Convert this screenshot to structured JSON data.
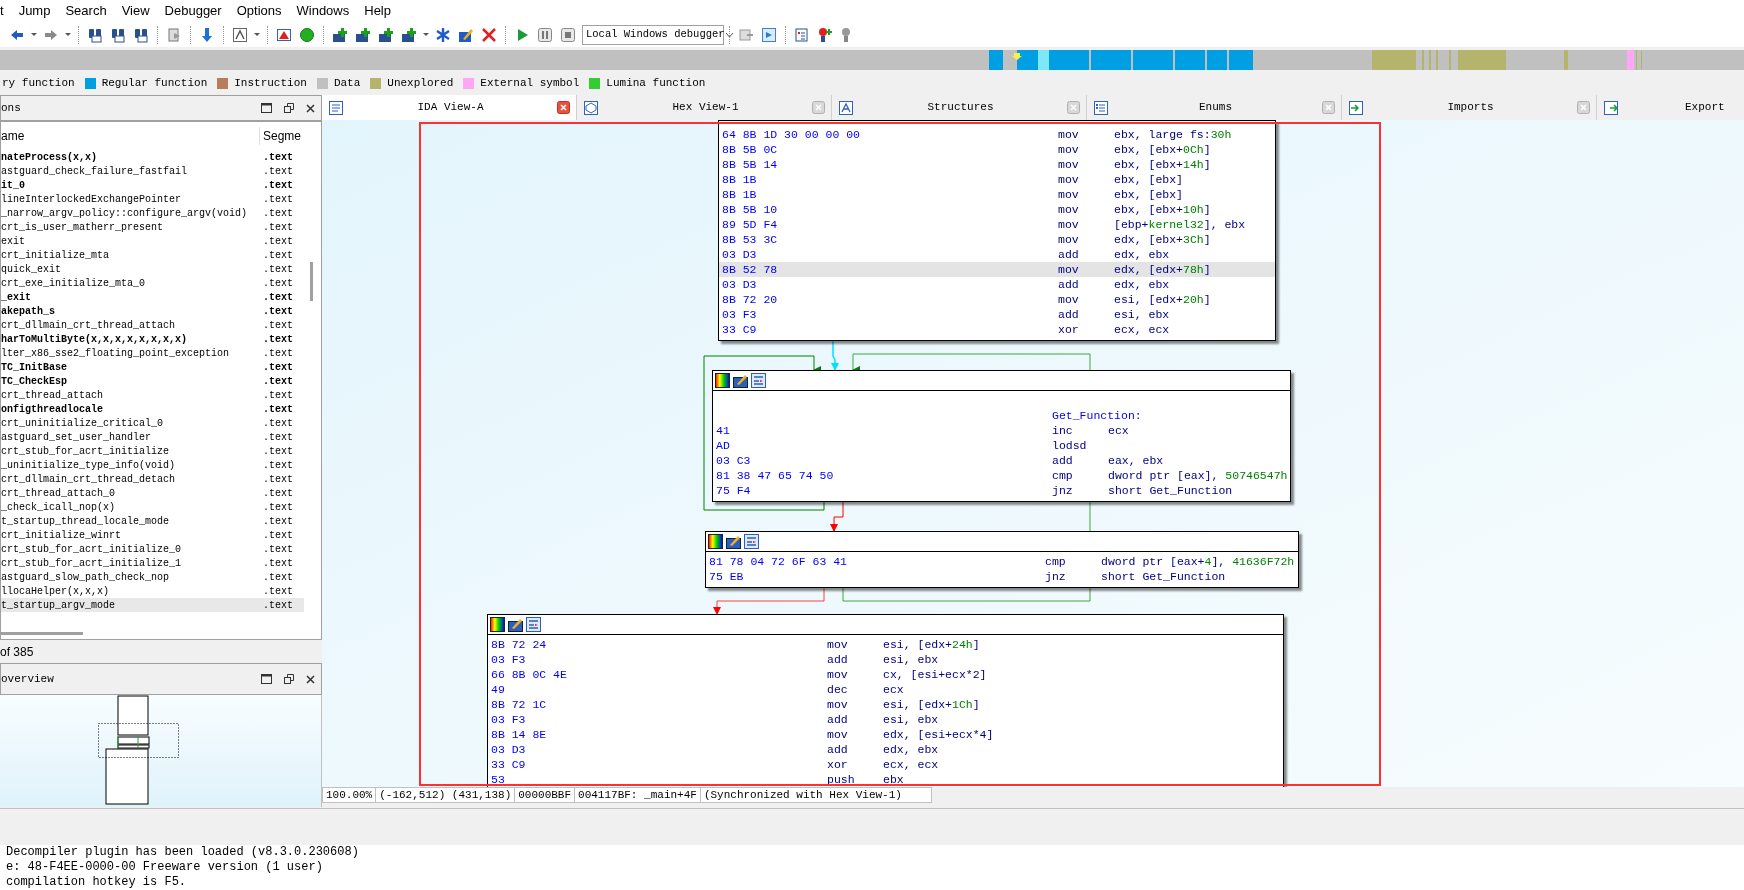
{
  "menu": [
    "t",
    "Jump",
    "Search",
    "View",
    "Debugger",
    "Options",
    "Windows",
    "Help"
  ],
  "toolbar": {
    "debugger_dropdown": "Local Windows debugger"
  },
  "legend": [
    {
      "label": "ry function"
    },
    {
      "label": "Regular function",
      "color": "#009fe3"
    },
    {
      "label": "Instruction",
      "color": "#b87c5c"
    },
    {
      "label": "Data",
      "color": "#c0c0c0"
    },
    {
      "label": "Unexplored",
      "color": "#b4b46c"
    },
    {
      "label": "External symbol",
      "color": "#ffa6f5"
    },
    {
      "label": "Lumina function",
      "color": "#33cc33"
    }
  ],
  "functions_panel": {
    "title": "ons",
    "columns": [
      "ame",
      "Segme"
    ],
    "rows": [
      {
        "name": "nateProcess(x,x)",
        "segment": ".text",
        "emphasized": true,
        "selected": false
      },
      {
        "name": "astguard_check_failure_fastfail",
        "segment": ".text",
        "emphasized": false,
        "selected": false
      },
      {
        "name": "it_0",
        "segment": ".text",
        "emphasized": true,
        "selected": false
      },
      {
        "name": "lineInterlockedExchangePointer",
        "segment": ".text",
        "emphasized": false,
        "selected": false
      },
      {
        "name": "_narrow_argv_policy::configure_argv(void)",
        "segment": ".text",
        "emphasized": false,
        "selected": false
      },
      {
        "name": "crt_is_user_matherr_present",
        "segment": ".text",
        "emphasized": false,
        "selected": false
      },
      {
        "name": "exit",
        "segment": ".text",
        "emphasized": false,
        "selected": false
      },
      {
        "name": "crt_initialize_mta",
        "segment": ".text",
        "emphasized": false,
        "selected": false
      },
      {
        "name": "quick_exit",
        "segment": ".text",
        "emphasized": false,
        "selected": false
      },
      {
        "name": "crt_exe_initialize_mta_0",
        "segment": ".text",
        "emphasized": false,
        "selected": false
      },
      {
        "name": "_exit",
        "segment": ".text",
        "emphasized": true,
        "selected": false
      },
      {
        "name": "akepath_s",
        "segment": ".text",
        "emphasized": true,
        "selected": false
      },
      {
        "name": "crt_dllmain_crt_thread_attach",
        "segment": ".text",
        "emphasized": false,
        "selected": false
      },
      {
        "name": "harToMultiByte(x,x,x,x,x,x,x,x)",
        "segment": ".text",
        "emphasized": true,
        "selected": false
      },
      {
        "name": "lter_x86_sse2_floating_point_exception",
        "segment": ".text",
        "emphasized": false,
        "selected": false
      },
      {
        "name": "TC_InitBase",
        "segment": ".text",
        "emphasized": true,
        "selected": false
      },
      {
        "name": "TC_CheckEsp",
        "segment": ".text",
        "emphasized": true,
        "selected": false
      },
      {
        "name": "crt_thread_attach",
        "segment": ".text",
        "emphasized": false,
        "selected": false
      },
      {
        "name": "onfigthreadlocale",
        "segment": ".text",
        "emphasized": true,
        "selected": false
      },
      {
        "name": "crt_uninitialize_critical_0",
        "segment": ".text",
        "emphasized": false,
        "selected": false
      },
      {
        "name": "astguard_set_user_handler",
        "segment": ".text",
        "emphasized": false,
        "selected": false
      },
      {
        "name": "crt_stub_for_acrt_initialize",
        "segment": ".text",
        "emphasized": false,
        "selected": false
      },
      {
        "name": "_uninitialize_type_info(void)",
        "segment": ".text",
        "emphasized": false,
        "selected": false
      },
      {
        "name": "crt_dllmain_crt_thread_detach",
        "segment": ".text",
        "emphasized": false,
        "selected": false
      },
      {
        "name": "crt_thread_attach_0",
        "segment": ".text",
        "emphasized": false,
        "selected": false
      },
      {
        "name": "_check_icall_nop(x)",
        "segment": ".text",
        "emphasized": false,
        "selected": false
      },
      {
        "name": "t_startup_thread_locale_mode",
        "segment": ".text",
        "emphasized": false,
        "selected": false
      },
      {
        "name": "crt_initialize_winrt",
        "segment": ".text",
        "emphasized": false,
        "selected": false
      },
      {
        "name": "crt_stub_for_acrt_initialize_0",
        "segment": ".text",
        "emphasized": false,
        "selected": false
      },
      {
        "name": "crt_stub_for_acrt_initialize_1",
        "segment": ".text",
        "emphasized": false,
        "selected": false
      },
      {
        "name": "astguard_slow_path_check_nop",
        "segment": ".text",
        "emphasized": false,
        "selected": false
      },
      {
        "name": "llocaHelper(x,x,x)",
        "segment": ".text",
        "emphasized": false,
        "selected": false
      },
      {
        "name": "t_startup_argv_mode",
        "segment": ".text",
        "emphasized": false,
        "selected": true
      }
    ],
    "count": "of 385"
  },
  "overview_panel": {
    "title": "overview"
  },
  "tabs": [
    {
      "label": "IDA View-A",
      "selected": true
    },
    {
      "label": "Hex View-1",
      "selected": false
    },
    {
      "label": "Structures",
      "selected": false
    },
    {
      "label": "Enums",
      "selected": false
    },
    {
      "label": "Imports",
      "selected": false
    },
    {
      "label": "Export",
      "selected": false
    }
  ],
  "graph": {
    "blocks": [
      {
        "header": false,
        "lines": [
          {
            "kind": "code",
            "bytes": "64 8B 1D 30 00 00 00",
            "mnemonic": "mov",
            "operands": [
              "ebx, large fs:",
              "30h"
            ],
            "selected": false
          },
          {
            "kind": "code",
            "bytes": "8B 5B 0C",
            "mnemonic": "mov",
            "operands": [
              "ebx, [ebx+",
              "0Ch",
              "]"
            ],
            "selected": false
          },
          {
            "kind": "code",
            "bytes": "8B 5B 14",
            "mnemonic": "mov",
            "operands": [
              "ebx, [ebx+",
              "14h",
              "]"
            ],
            "selected": false
          },
          {
            "kind": "code",
            "bytes": "8B 1B",
            "mnemonic": "mov",
            "operands": [
              "ebx, [ebx]"
            ],
            "selected": false
          },
          {
            "kind": "code",
            "bytes": "8B 1B",
            "mnemonic": "mov",
            "operands": [
              "ebx, [ebx]"
            ],
            "selected": false
          },
          {
            "kind": "code",
            "bytes": "8B 5B 10",
            "mnemonic": "mov",
            "operands": [
              "ebx, [ebx+",
              "10h",
              "]"
            ],
            "selected": false
          },
          {
            "kind": "code",
            "bytes": "89 5D F4",
            "mnemonic": "mov",
            "operands": [
              "[ebp+",
              "kernel32",
              "], ebx"
            ],
            "selected": false
          },
          {
            "kind": "code",
            "bytes": "8B 53 3C",
            "mnemonic": "mov",
            "operands": [
              "edx, [ebx+",
              "3Ch",
              "]"
            ],
            "selected": false
          },
          {
            "kind": "code",
            "bytes": "03 D3",
            "mnemonic": "add",
            "operands": [
              "edx, ebx"
            ],
            "selected": false
          },
          {
            "kind": "code",
            "bytes": "8B 52 78",
            "mnemonic": "mov",
            "operands": [
              "edx, [edx+",
              "78h",
              "]"
            ],
            "selected": true
          },
          {
            "kind": "code",
            "bytes": "03 D3",
            "mnemonic": "add",
            "operands": [
              "edx, ebx"
            ],
            "selected": false
          },
          {
            "kind": "code",
            "bytes": "8B 72 20",
            "mnemonic": "mov",
            "operands": [
              "esi, [edx+",
              "20h",
              "]"
            ],
            "selected": false
          },
          {
            "kind": "code",
            "bytes": "03 F3",
            "mnemonic": "add",
            "operands": [
              "esi, ebx"
            ],
            "selected": false
          },
          {
            "kind": "code",
            "bytes": "33 C9",
            "mnemonic": "xor",
            "operands": [
              "ecx, ecx"
            ],
            "selected": false
          }
        ]
      },
      {
        "header": true,
        "lines": [
          {
            "kind": "blank"
          },
          {
            "kind": "label",
            "text": "Get_Function:"
          },
          {
            "kind": "code",
            "bytes": "41",
            "mnemonic": "inc",
            "operands": [
              "ecx"
            ]
          },
          {
            "kind": "code",
            "bytes": "AD",
            "mnemonic": "lodsd"
          },
          {
            "kind": "code",
            "bytes": "03 C3",
            "mnemonic": "add",
            "operands": [
              "eax, ebx"
            ]
          },
          {
            "kind": "code",
            "bytes": "81 38 47 65 74 50",
            "mnemonic": "cmp",
            "operands": [
              "dword ptr [eax], ",
              "50746547h"
            ]
          },
          {
            "kind": "code",
            "bytes": "75 F4",
            "mnemonic": "jnz",
            "operands": [
              "short Get_Function"
            ]
          }
        ]
      },
      {
        "header": true,
        "lines": [
          {
            "kind": "code",
            "bytes": "81 78 04 72 6F 63 41",
            "mnemonic": "cmp",
            "operands": [
              "dword ptr [eax+",
              "4",
              "], ",
              "41636F72h"
            ]
          },
          {
            "kind": "code",
            "bytes": "75 EB",
            "mnemonic": "jnz",
            "operands": [
              "short Get_Function"
            ]
          }
        ]
      },
      {
        "header": true,
        "lines": [
          {
            "kind": "code",
            "bytes": "8B 72 24",
            "mnemonic": "mov",
            "operands": [
              "esi, [edx+",
              "24h",
              "]"
            ]
          },
          {
            "kind": "code",
            "bytes": "03 F3",
            "mnemonic": "add",
            "operands": [
              "esi, ebx"
            ]
          },
          {
            "kind": "code",
            "bytes": "66 8B 0C 4E",
            "mnemonic": "mov",
            "operands": [
              "cx, [esi+ecx*2]"
            ]
          },
          {
            "kind": "code",
            "bytes": "49",
            "mnemonic": "dec",
            "operands": [
              "ecx"
            ]
          },
          {
            "kind": "code",
            "bytes": "8B 72 1C",
            "mnemonic": "mov",
            "operands": [
              "esi, [edx+",
              "1Ch",
              "]"
            ]
          },
          {
            "kind": "code",
            "bytes": "03 F3",
            "mnemonic": "add",
            "operands": [
              "esi, ebx"
            ]
          },
          {
            "kind": "code",
            "bytes": "8B 14 8E",
            "mnemonic": "mov",
            "operands": [
              "edx, [esi+ecx*4]"
            ]
          },
          {
            "kind": "code",
            "bytes": "03 D3",
            "mnemonic": "add",
            "operands": [
              "edx, ebx"
            ]
          },
          {
            "kind": "code",
            "bytes": "33 C9",
            "mnemonic": "xor",
            "operands": [
              "ecx, ecx"
            ]
          },
          {
            "kind": "code",
            "bytes": "53",
            "mnemonic": "push",
            "operands": [
              "ebx"
            ]
          }
        ]
      }
    ]
  },
  "graph_status": [
    "100.00%",
    "(-162,512) (431,138)",
    "00000BBF",
    "004117BF: _main+4F",
    "(Synchronized with Hex View-1)"
  ],
  "output": [
    "Decompiler plugin has been loaded (v8.3.0.230608)",
    "e: 48-F4EE-0000-00 Freeware version (1 user)",
    "compilation hotkey is F5."
  ]
}
